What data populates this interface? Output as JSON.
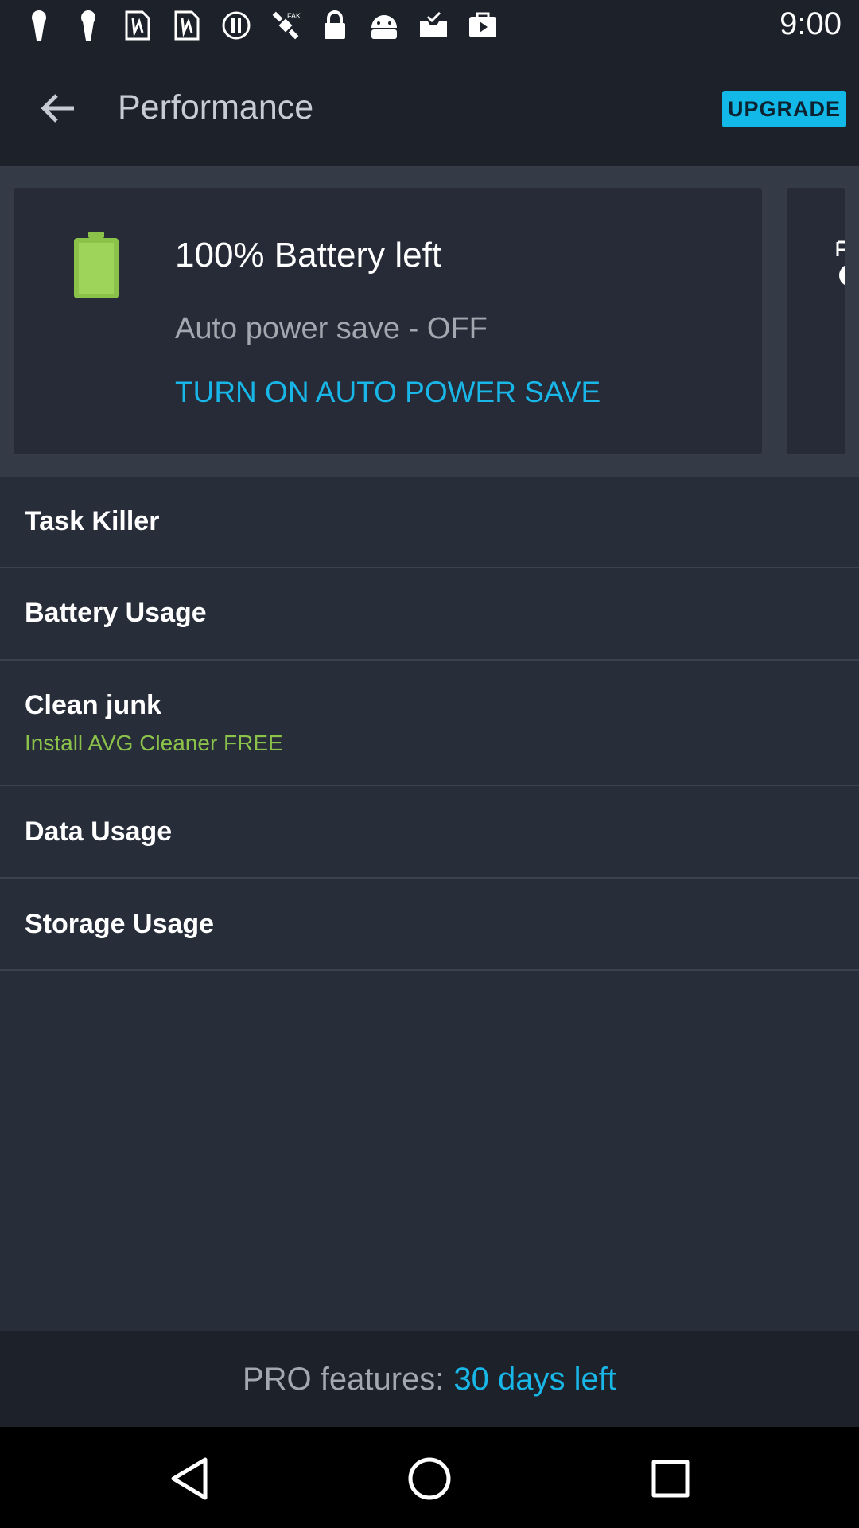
{
  "status_bar": {
    "time": "9:00",
    "icons": [
      "keyhole-icon",
      "keyhole-icon",
      "sim-card-icon",
      "sim-card-icon",
      "alert-icon",
      "satellite-icon",
      "lock-icon",
      "android-icon",
      "inbox-check-icon",
      "play-store-icon"
    ]
  },
  "header": {
    "title": "Performance",
    "upgrade_label": "UPGRADE"
  },
  "battery_card": {
    "title": "100% Battery left",
    "subtitle": "Auto power save - OFF",
    "action_label": "TURN ON AUTO POWER SAVE",
    "level": 1.0
  },
  "menu": {
    "task_killer": "Task Killer",
    "battery_usage": "Battery Usage",
    "clean_junk": "Clean junk",
    "clean_junk_sub": "Install AVG Cleaner FREE",
    "data_usage": "Data Usage",
    "storage_usage": "Storage Usage"
  },
  "footer": {
    "pro_label": "PRO features:",
    "days_left": "30 days left"
  },
  "colors": {
    "accent": "#19b6e8",
    "battery_green": "#8bc34a",
    "background": "#282d3a",
    "bar": "#1d2129"
  }
}
